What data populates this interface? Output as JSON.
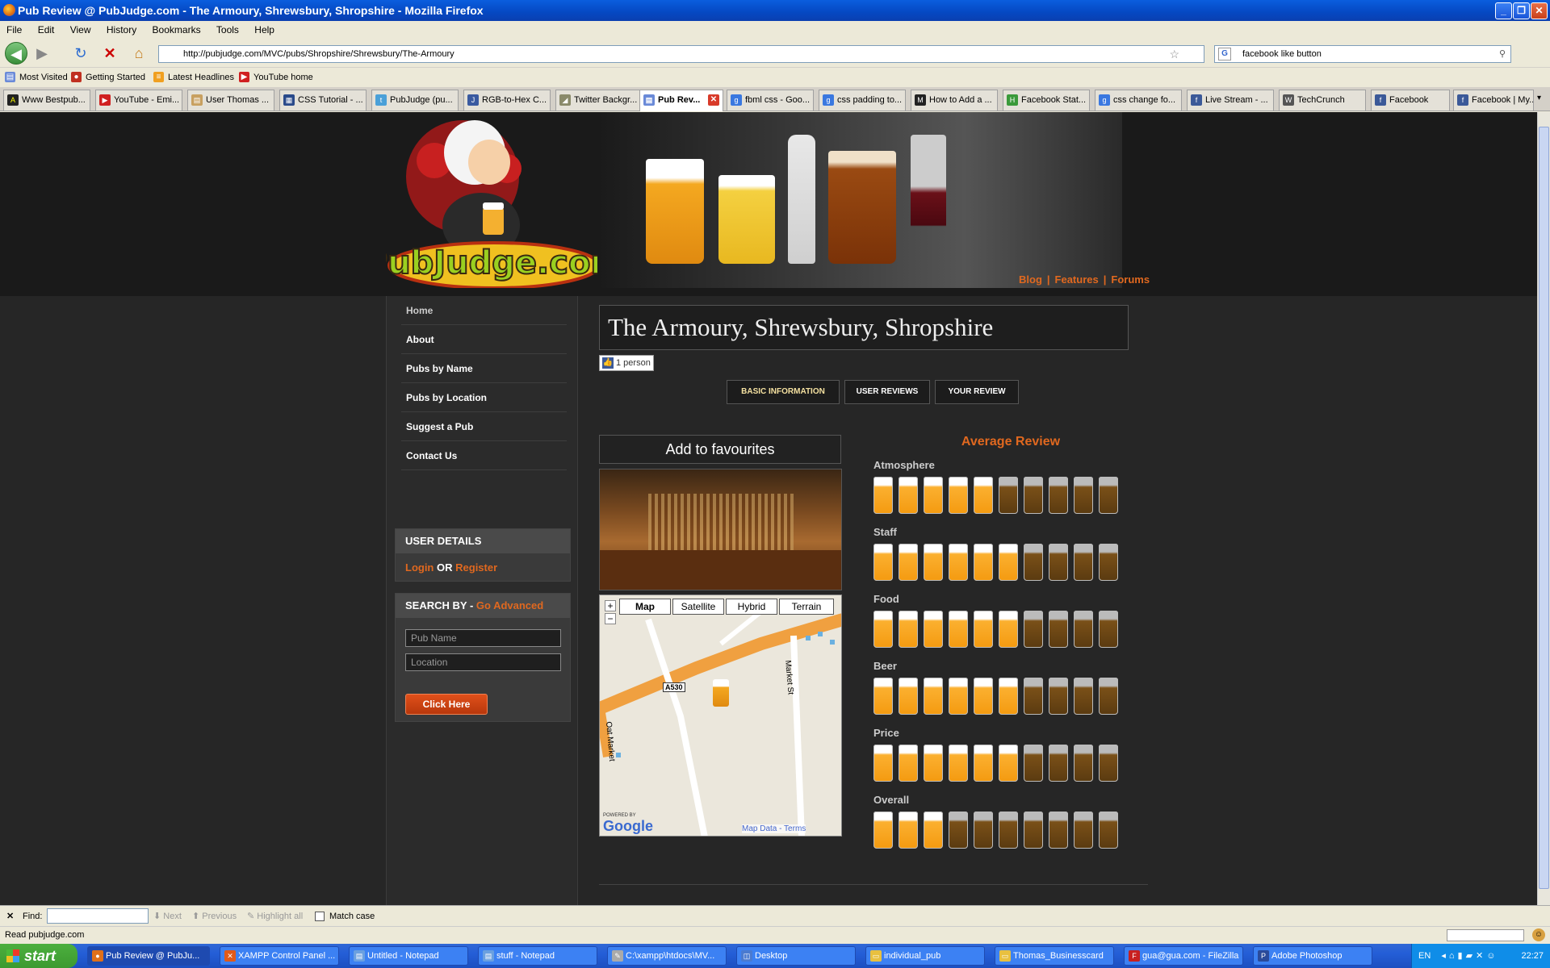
{
  "window": {
    "title": "Pub Review @ PubJudge.com - The Armoury, Shrewsbury, Shropshire - Mozilla Firefox"
  },
  "menu": [
    "File",
    "Edit",
    "View",
    "History",
    "Bookmarks",
    "Tools",
    "Help"
  ],
  "nav": {
    "url": "http://pubjudge.com/MVC/pubs/Shropshire/Shrewsbury/The-Armoury",
    "search": "facebook like button"
  },
  "bookmarks": [
    "Most Visited",
    "Getting Started",
    "Latest Headlines",
    "YouTube home"
  ],
  "tabs": [
    "Www Bestpub...",
    "YouTube - Emi...",
    "User Thomas ...",
    "CSS Tutorial - ...",
    "PubJudge (pu...",
    "RGB-to-Hex C...",
    "Twitter Backgr...",
    "Pub Rev...",
    "fbml css - Goo...",
    "css padding to...",
    "How to Add a ...",
    "Facebook Stat...",
    "css change fo...",
    "Live Stream - ...",
    "TechCrunch",
    "Facebook",
    "Facebook | My..."
  ],
  "site": {
    "logo_text": "PubJudge.com",
    "top_links": [
      "Blog",
      "Features",
      "Forums"
    ],
    "sidebar": [
      "Home",
      "About",
      "Pubs by Name",
      "Pubs by Location",
      "Suggest a Pub",
      "Contact Us"
    ],
    "user_details": {
      "heading": "USER DETAILS",
      "login": "Login",
      "or": "OR",
      "register": "Register"
    },
    "search": {
      "heading": "SEARCH BY - ",
      "advanced": "Go Advanced",
      "pub_placeholder": "Pub Name",
      "location_placeholder": "Location",
      "button": "Click Here"
    },
    "pub_title": "The Armoury, Shrewsbury, Shropshire",
    "like": "1 person",
    "info_tabs": [
      "BASIC INFORMATION",
      "USER REVIEWS",
      "YOUR REVIEW"
    ],
    "favourites": "Add to favourites",
    "map": {
      "types": [
        "Map",
        "Satellite",
        "Hybrid",
        "Terrain"
      ],
      "labels": [
        "A530",
        "Market St",
        "Oat Market"
      ],
      "powered": "POWERED BY",
      "google": "Google",
      "footer": "Map Data - Terms"
    },
    "average_title": "Average Review",
    "ratings": [
      {
        "label": "Atmosphere",
        "value": 5,
        "max": 10
      },
      {
        "label": "Staff",
        "value": 6,
        "max": 10
      },
      {
        "label": "Food",
        "value": 6,
        "max": 10
      },
      {
        "label": "Beer",
        "value": 6,
        "max": 10
      },
      {
        "label": "Price",
        "value": 6,
        "max": 10
      },
      {
        "label": "Overall",
        "value": 3,
        "max": 10
      }
    ]
  },
  "findbar": {
    "label": "Find:",
    "next": "Next",
    "previous": "Previous",
    "highlight": "Highlight all",
    "match_case": "Match case"
  },
  "status": "Read pubjudge.com",
  "taskbar": {
    "start": "start",
    "items": [
      "Pub Review @ PubJu...",
      "XAMPP Control Panel ...",
      "Untitled - Notepad",
      "stuff - Notepad",
      "C:\\xampp\\htdocs\\MV...",
      "Desktop",
      "individual_pub",
      "Thomas_Businesscard",
      "gua@gua.com - FileZilla",
      "Adobe Photoshop"
    ],
    "lang": "EN",
    "clock": "22:27"
  }
}
